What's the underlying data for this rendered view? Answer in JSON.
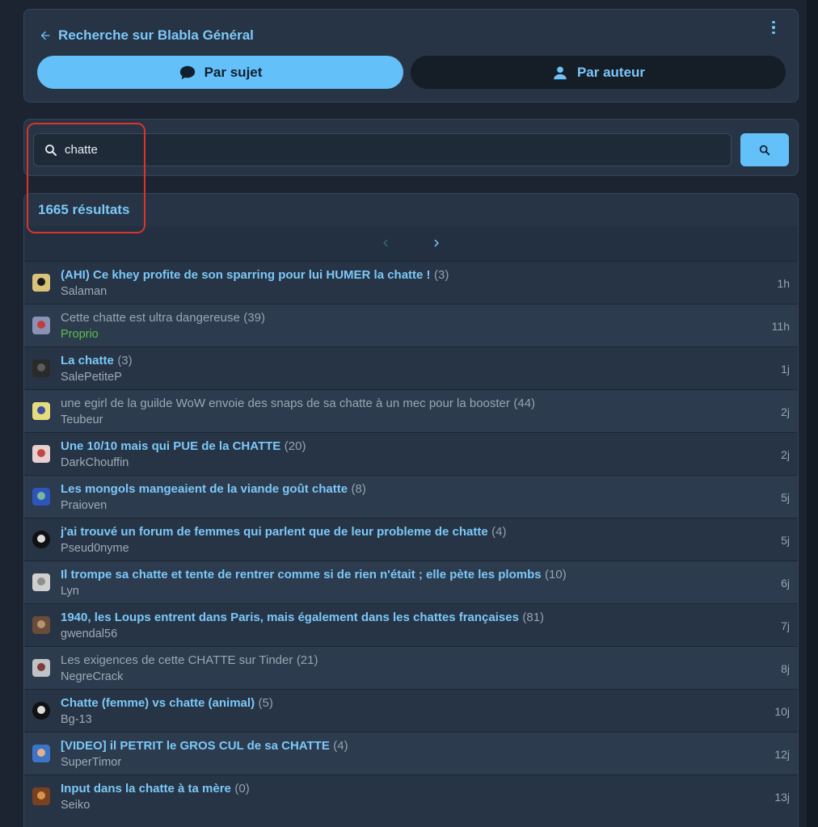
{
  "header": {
    "title": "Recherche sur Blabla Général",
    "tab_subject": "Par sujet",
    "tab_author": "Par auteur"
  },
  "search": {
    "value": "chatte"
  },
  "results": {
    "count_label": "1665 résultats"
  },
  "colors": {
    "accent": "#63c0f8",
    "link": "#7cc8f8",
    "admin": "#5cbf4a",
    "annotation": "#d9352a"
  },
  "topics": [
    {
      "title": "(AHI) Ce khey profite de son sparring pour lui HUMER la chatte !",
      "count": "(3)",
      "author": "Salaman",
      "time": "1h"
    },
    {
      "title": "Cette chatte est ultra dangereuse",
      "count": "(39)",
      "author": "Proprio",
      "time": "11h"
    },
    {
      "title": "La chatte",
      "count": "(3)",
      "author": "SalePetiteP",
      "time": "1j"
    },
    {
      "title": "une egirl de la guilde WoW envoie des snaps de sa chatte à un mec pour la booster",
      "count": "(44)",
      "author": "Teubeur",
      "time": "2j"
    },
    {
      "title": "Une 10/10 mais qui PUE de la CHATTE",
      "count": "(20)",
      "author": "DarkChouffin",
      "time": "2j"
    },
    {
      "title": "Les mongols mangeaient de la viande goût chatte",
      "count": "(8)",
      "author": "Praioven",
      "time": "5j"
    },
    {
      "title": "j'ai trouvé un forum de femmes qui parlent que de leur probleme de chatte",
      "count": "(4)",
      "author": "Pseud0nyme",
      "time": "5j"
    },
    {
      "title": "Il trompe sa chatte et tente de rentrer comme si de rien n'était ; elle pète les plombs",
      "count": "(10)",
      "author": "Lyn",
      "time": "6j"
    },
    {
      "title": "1940, les Loups entrent dans Paris, mais également dans les chattes françaises",
      "count": "(81)",
      "author": "gwendal56",
      "time": "7j"
    },
    {
      "title": "Les exigences de cette CHATTE sur Tinder",
      "count": "(21)",
      "author": "NegreCrack",
      "time": "8j"
    },
    {
      "title": "Chatte (femme) vs chatte (animal)",
      "count": "(5)",
      "author": "Bg-13",
      "time": "10j"
    },
    {
      "title": "[VIDEO] il PETRIT le GROS CUL de sa CHATTE",
      "count": "(4)",
      "author": "SuperTimor",
      "time": "12j"
    },
    {
      "title": "Input dans la chatte à ta mère",
      "count": "(0)",
      "author": "Seiko",
      "time": "13j"
    }
  ]
}
